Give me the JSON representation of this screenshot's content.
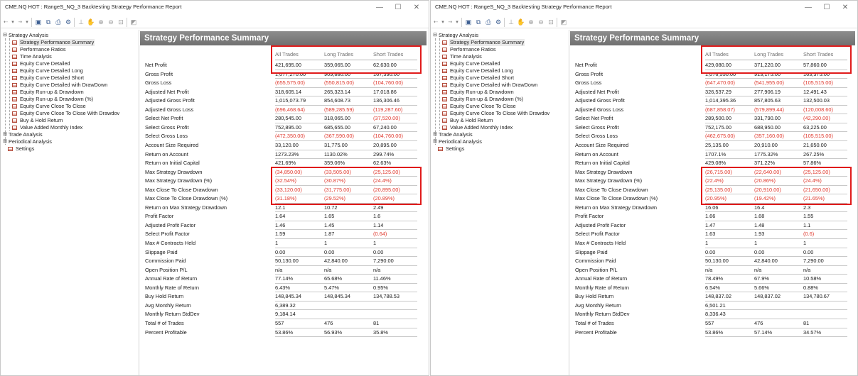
{
  "windows": [
    {
      "title": "CME.NQ HOT : RangeS_NQ_3 Backtesting Strategy Performance Report",
      "tree": {
        "root": "Strategy Analysis",
        "items": [
          "Strategy Performance Summary",
          "Performance Ratios",
          "Time Analysis",
          "Equity Curve Detailed",
          "Equity Curve Detailed Long",
          "Equity Curve Detailed Short",
          "Equity Curve Detailed with DrawDown",
          "Equity Run-up & Drawdown",
          "Equity Run-up & Drawdown (%)",
          "Equity Curve Close To Close",
          "Equity Curve Close To Close With Drawdov",
          "Buy & Hold Return",
          "Value Added Monthly Index"
        ],
        "trade_analysis": "Trade Analysis",
        "periodical_analysis": "Periodical Analysis",
        "settings": "Settings"
      },
      "report": {
        "header": "Strategy Performance Summary",
        "columns": [
          "All Trades",
          "Long Trades",
          "Short Trades"
        ],
        "rows": [
          {
            "label": "Net Profit",
            "all": "421,695.00",
            "long": "359,065.00",
            "short": "62,630.00"
          },
          {
            "label": "Gross Profit",
            "all": "1,077,270.00",
            "long": "909,880.00",
            "short": "167,390.00"
          },
          {
            "label": "Gross Loss",
            "all": "(655,575.00)",
            "long": "(550,815.00)",
            "short": "(104,760.00)"
          },
          {
            "label": "Adjusted Net Profit",
            "all": "318,605.14",
            "long": "265,323.14",
            "short": "17,018.86"
          },
          {
            "label": "Adjusted Gross Profit",
            "all": "1,015,073.79",
            "long": "854,608.73",
            "short": "136,306.46"
          },
          {
            "label": "Adjusted Gross Loss",
            "all": "(696,468.64)",
            "long": "(589,285.59)",
            "short": "(119,287.60)"
          },
          {
            "label": "Select Net Profit",
            "all": "280,545.00",
            "long": "318,065.00",
            "short": "(37,520.00)"
          },
          {
            "label": "Select Gross Profit",
            "all": "752,895.00",
            "long": "685,655.00",
            "short": "67,240.00"
          },
          {
            "label": "Select Gross Loss",
            "all": "(472,350.00)",
            "long": "(367,590.00)",
            "short": "(104,760.00)"
          },
          {
            "label": "Account Size Required",
            "all": "33,120.00",
            "long": "31,775.00",
            "short": "20,895.00"
          },
          {
            "label": "Return on Account",
            "all": "1273.23%",
            "long": "1130.02%",
            "short": "299.74%"
          },
          {
            "label": "Return on Initial Capital",
            "all": "421.69%",
            "long": "359.06%",
            "short": "62.63%"
          },
          {
            "label": "Max Strategy Drawdown",
            "all": "(34,850.00)",
            "long": "(33,505.00)",
            "short": "(25,125.00)"
          },
          {
            "label": "Max Strategy Drawdown (%)",
            "all": "(32.54%)",
            "long": "(30.87%)",
            "short": "(24.4%)"
          },
          {
            "label": "Max Close To Close Drawdown",
            "all": "(33,120.00)",
            "long": "(31,775.00)",
            "short": "(20,895.00)"
          },
          {
            "label": "Max Close To Close Drawdown (%)",
            "all": "(31.18%)",
            "long": "(29.52%)",
            "short": "(20.89%)"
          },
          {
            "label": "Return on Max Strategy Drawdown",
            "all": "12.1",
            "long": "10.72",
            "short": "2.49"
          },
          {
            "label": "Profit Factor",
            "all": "1.64",
            "long": "1.65",
            "short": "1.6"
          },
          {
            "label": "Adjusted Profit Factor",
            "all": "1.46",
            "long": "1.45",
            "short": "1.14"
          },
          {
            "label": "Select Profit Factor",
            "all": "1.59",
            "long": "1.87",
            "short": "(0.64)"
          },
          {
            "label": "Max # Contracts Held",
            "all": "1",
            "long": "1",
            "short": "1"
          },
          {
            "label": "Slippage Paid",
            "all": "0.00",
            "long": "0.00",
            "short": "0.00"
          },
          {
            "label": "Commission Paid",
            "all": "50,130.00",
            "long": "42,840.00",
            "short": "7,290.00"
          },
          {
            "label": "Open Position P/L",
            "all": "n/a",
            "long": "n/a",
            "short": "n/a"
          },
          {
            "label": "Annual Rate of Return",
            "all": "77.14%",
            "long": "65.68%",
            "short": "11.46%"
          },
          {
            "label": "Monthly Rate of Return",
            "all": "6.43%",
            "long": "5.47%",
            "short": "0.95%"
          },
          {
            "label": "Buy  Hold Return",
            "all": "148,845.34",
            "long": "148,845.34",
            "short": "134,788.53"
          },
          {
            "label": "Avg Monthly Return",
            "all": "6,389.32",
            "long": "",
            "short": ""
          },
          {
            "label": "Monthly Return StdDev",
            "all": "9,184.14",
            "long": "",
            "short": ""
          },
          {
            "label": "Total # of Trades",
            "all": "557",
            "long": "476",
            "short": "81"
          },
          {
            "label": "Percent Profitable",
            "all": "53.86%",
            "long": "56.93%",
            "short": "35.8%"
          }
        ]
      }
    },
    {
      "title": "CME.NQ HOT : RangeS_NQ_3 Backtesting Strategy Performance Report",
      "tree": {
        "root": "Strategy Analysis",
        "items": [
          "Strategy Performance Summary",
          "Performance Ratios",
          "Time Analysis",
          "Equity Curve Detailed",
          "Equity Curve Detailed Long",
          "Equity Curve Detailed Short",
          "Equity Curve Detailed with DrawDown",
          "Equity Run-up & Drawdown",
          "Equity Run-up & Drawdown (%)",
          "Equity Curve Close To Close",
          "Equity Curve Close To Close With Drawdov",
          "Buy & Hold Return",
          "Value Added Monthly Index"
        ],
        "trade_analysis": "Trade Analysis",
        "periodical_analysis": "Periodical Analysis",
        "settings": "Settings"
      },
      "report": {
        "header": "Strategy Performance Summary",
        "columns": [
          "All Trades",
          "Long Trades",
          "Short Trades"
        ],
        "rows": [
          {
            "label": "Net Profit",
            "all": "429,080.00",
            "long": "371,220.00",
            "short": "57,860.00"
          },
          {
            "label": "Gross Profit",
            "all": "1,076,550.00",
            "long": "913,175.00",
            "short": "163,375.00"
          },
          {
            "label": "Gross Loss",
            "all": "(647,470.00)",
            "long": "(541,955.00)",
            "short": "(105,515.00)"
          },
          {
            "label": "Adjusted Net Profit",
            "all": "326,537.29",
            "long": "277,906.19",
            "short": "12,491.43"
          },
          {
            "label": "Adjusted Gross Profit",
            "all": "1,014,395.36",
            "long": "857,805.63",
            "short": "132,500.03"
          },
          {
            "label": "Adjusted Gross Loss",
            "all": "(687,858.07)",
            "long": "(579,899.44)",
            "short": "(120,008.60)"
          },
          {
            "label": "Select Net Profit",
            "all": "289,500.00",
            "long": "331,790.00",
            "short": "(42,290.00)"
          },
          {
            "label": "Select Gross Profit",
            "all": "752,175.00",
            "long": "688,950.00",
            "short": "63,225.00"
          },
          {
            "label": "Select Gross Loss",
            "all": "(462,675.00)",
            "long": "(357,160.00)",
            "short": "(105,515.00)"
          },
          {
            "label": "Account Size Required",
            "all": "25,135.00",
            "long": "20,910.00",
            "short": "21,650.00"
          },
          {
            "label": "Return on Account",
            "all": "1707.1%",
            "long": "1775.32%",
            "short": "267.25%"
          },
          {
            "label": "Return on Initial Capital",
            "all": "429.08%",
            "long": "371.22%",
            "short": "57.86%"
          },
          {
            "label": "Max Strategy Drawdown",
            "all": "(26,715.00)",
            "long": "(22,640.00)",
            "short": "(25,125.00)"
          },
          {
            "label": "Max Strategy Drawdown (%)",
            "all": "(22.4%)",
            "long": "(20.86%)",
            "short": "(24.4%)"
          },
          {
            "label": "Max Close To Close Drawdown",
            "all": "(25,135.00)",
            "long": "(20,910.00)",
            "short": "(21,650.00)"
          },
          {
            "label": "Max Close To Close Drawdown (%)",
            "all": "(20.95%)",
            "long": "(19.42%)",
            "short": "(21.65%)"
          },
          {
            "label": "Return on Max Strategy Drawdown",
            "all": "16.06",
            "long": "16.4",
            "short": "2.3"
          },
          {
            "label": "Profit Factor",
            "all": "1.66",
            "long": "1.68",
            "short": "1.55"
          },
          {
            "label": "Adjusted Profit Factor",
            "all": "1.47",
            "long": "1.48",
            "short": "1.1"
          },
          {
            "label": "Select Profit Factor",
            "all": "1.63",
            "long": "1.93",
            "short": "(0.6)"
          },
          {
            "label": "Max # Contracts Held",
            "all": "1",
            "long": "1",
            "short": "1"
          },
          {
            "label": "Slippage Paid",
            "all": "0.00",
            "long": "0.00",
            "short": "0.00"
          },
          {
            "label": "Commission Paid",
            "all": "50,130.00",
            "long": "42,840.00",
            "short": "7,290.00"
          },
          {
            "label": "Open Position P/L",
            "all": "n/a",
            "long": "n/a",
            "short": "n/a"
          },
          {
            "label": "Annual Rate of Return",
            "all": "78.49%",
            "long": "67.9%",
            "short": "10.58%"
          },
          {
            "label": "Monthly Rate of Return",
            "all": "6.54%",
            "long": "5.66%",
            "short": "0.88%"
          },
          {
            "label": "Buy  Hold Return",
            "all": "148,837.02",
            "long": "148,837.02",
            "short": "134,780.67"
          },
          {
            "label": "Avg Monthly Return",
            "all": "6,501.21",
            "long": "",
            "short": ""
          },
          {
            "label": "Monthly Return StdDev",
            "all": "8,336.43",
            "long": "",
            "short": ""
          },
          {
            "label": "Total # of Trades",
            "all": "557",
            "long": "476",
            "short": "81"
          },
          {
            "label": "Percent Profitable",
            "all": "53.86%",
            "long": "57.14%",
            "short": "34.57%"
          }
        ]
      }
    }
  ],
  "highlight_color": "#e01b1b",
  "negative_color": "#e0392e"
}
